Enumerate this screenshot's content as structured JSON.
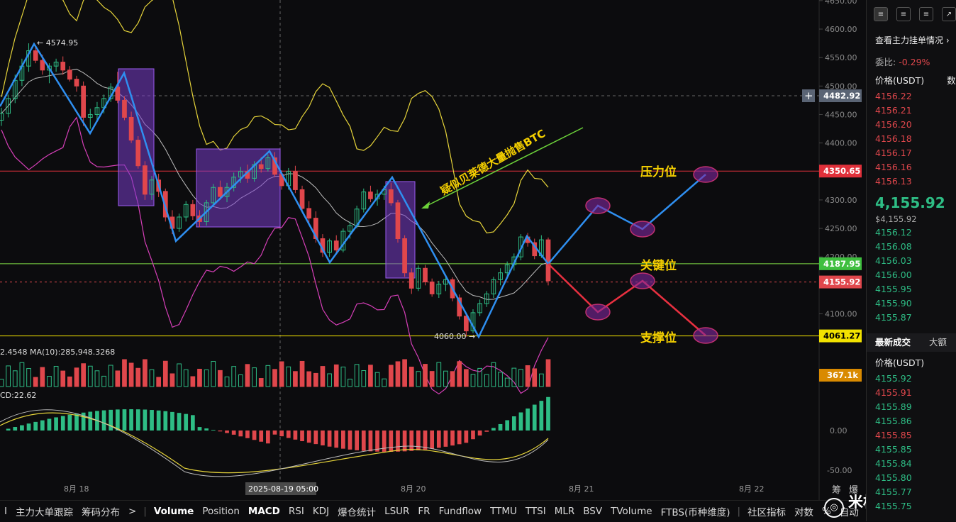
{
  "chart_data": {
    "type": "candlestick",
    "price_axis": {
      "ticks": [
        4650,
        4600,
        4550,
        4500,
        4450,
        4400,
        4350,
        4300,
        4250,
        4200,
        4150,
        4100
      ],
      "tick_labels": [
        "4650.00",
        "4600.00",
        "4550.00",
        "4500.00",
        "4450.00",
        "4400.00",
        "4350.00",
        "4300.00",
        "4250.00",
        "4200.00",
        "4150.00",
        "4100.00"
      ],
      "range": [
        4055,
        4655
      ]
    },
    "time_axis": {
      "labels": [
        "8月 18",
        "8月 19",
        "8月 20",
        "8月 21",
        "8月 22"
      ],
      "crosshair_label": "2025-08-19 05:00"
    },
    "price_tags": [
      {
        "price": 4482.92,
        "label": "4482.92",
        "color": "#5a6474"
      },
      {
        "price": 4350.65,
        "label": "4350.65",
        "color": "#e0303a"
      },
      {
        "price": 4187.95,
        "label": "4187.95",
        "color": "#3fbf3f"
      },
      {
        "price": 4155.92,
        "label": "4155.92",
        "color": "#e0474c"
      },
      {
        "price": 4061.27,
        "label": "4061.27",
        "color": "#f2e200"
      }
    ],
    "horizontal_levels": [
      {
        "price": 4350.65,
        "color": "#e0303a",
        "name": "压力位"
      },
      {
        "price": 4187.95,
        "color": "#7fdc44",
        "name": "关键位"
      },
      {
        "price": 4061.27,
        "color": "#f2e200",
        "name": "支撑位"
      }
    ],
    "annotations": {
      "high_label": "← 4574.95",
      "low_label": "4060.00 →",
      "main_note": "疑似贝莱德大量抛售BTC"
    },
    "candles": [
      [
        4440,
        4462,
        4430,
        4452
      ],
      [
        4452,
        4485,
        4445,
        4478
      ],
      [
        4478,
        4520,
        4470,
        4510
      ],
      [
        4510,
        4548,
        4500,
        4535
      ],
      [
        4535,
        4575,
        4525,
        4562
      ],
      [
        4562,
        4570,
        4540,
        4545
      ],
      [
        4545,
        4555,
        4520,
        4528
      ],
      [
        4528,
        4540,
        4505,
        4535
      ],
      [
        4535,
        4548,
        4525,
        4542
      ],
      [
        4542,
        4552,
        4520,
        4528
      ],
      [
        4528,
        4535,
        4508,
        4512
      ],
      [
        4512,
        4518,
        4490,
        4500
      ],
      [
        4500,
        4508,
        4430,
        4445
      ],
      [
        4445,
        4460,
        4425,
        4450
      ],
      [
        4450,
        4472,
        4440,
        4462
      ],
      [
        4462,
        4485,
        4452,
        4478
      ],
      [
        4478,
        4505,
        4472,
        4498
      ],
      [
        4498,
        4525,
        4470,
        4475
      ],
      [
        4475,
        4482,
        4440,
        4445
      ],
      [
        4445,
        4455,
        4400,
        4405
      ],
      [
        4405,
        4412,
        4355,
        4360
      ],
      [
        4360,
        4368,
        4300,
        4310
      ],
      [
        4310,
        4342,
        4300,
        4335
      ],
      [
        4335,
        4346,
        4305,
        4315
      ],
      [
        4315,
        4320,
        4262,
        4270
      ],
      [
        4270,
        4282,
        4240,
        4250
      ],
      [
        4250,
        4276,
        4244,
        4270
      ],
      [
        4270,
        4298,
        4262,
        4292
      ],
      [
        4292,
        4300,
        4265,
        4272
      ],
      [
        4272,
        4282,
        4252,
        4262
      ],
      [
        4262,
        4300,
        4255,
        4295
      ],
      [
        4295,
        4328,
        4288,
        4322
      ],
      [
        4322,
        4334,
        4300,
        4306
      ],
      [
        4306,
        4330,
        4296,
        4322
      ],
      [
        4322,
        4348,
        4315,
        4340
      ],
      [
        4340,
        4358,
        4330,
        4350
      ],
      [
        4350,
        4362,
        4330,
        4338
      ],
      [
        4338,
        4368,
        4332,
        4362
      ],
      [
        4362,
        4375,
        4348,
        4355
      ],
      [
        4355,
        4380,
        4350,
        4374
      ],
      [
        4374,
        4384,
        4340,
        4345
      ],
      [
        4345,
        4352,
        4318,
        4325
      ],
      [
        4325,
        4356,
        4318,
        4350
      ],
      [
        4350,
        4360,
        4312,
        4318
      ],
      [
        4318,
        4325,
        4278,
        4285
      ],
      [
        4285,
        4298,
        4260,
        4268
      ],
      [
        4268,
        4280,
        4225,
        4232
      ],
      [
        4232,
        4240,
        4200,
        4208
      ],
      [
        4208,
        4232,
        4200,
        4228
      ],
      [
        4228,
        4238,
        4205,
        4212
      ],
      [
        4212,
        4250,
        4208,
        4245
      ],
      [
        4245,
        4262,
        4232,
        4255
      ],
      [
        4255,
        4290,
        4250,
        4284
      ],
      [
        4284,
        4320,
        4278,
        4314
      ],
      [
        4314,
        4325,
        4296,
        4302
      ],
      [
        4302,
        4318,
        4290,
        4310
      ],
      [
        4310,
        4325,
        4300,
        4318
      ],
      [
        4318,
        4330,
        4290,
        4295
      ],
      [
        4295,
        4300,
        4225,
        4232
      ],
      [
        4232,
        4238,
        4165,
        4172
      ],
      [
        4172,
        4180,
        4135,
        4145
      ],
      [
        4145,
        4185,
        4140,
        4180
      ],
      [
        4180,
        4186,
        4150,
        4156
      ],
      [
        4156,
        4162,
        4130,
        4135
      ],
      [
        4135,
        4158,
        4128,
        4152
      ],
      [
        4152,
        4168,
        4140,
        4160
      ],
      [
        4160,
        4164,
        4122,
        4128
      ],
      [
        4128,
        4134,
        4090,
        4096
      ],
      [
        4096,
        4100,
        4060,
        4070
      ],
      [
        4070,
        4108,
        4066,
        4102
      ],
      [
        4102,
        4125,
        4096,
        4118
      ],
      [
        4118,
        4140,
        4112,
        4135
      ],
      [
        4135,
        4165,
        4128,
        4160
      ],
      [
        4160,
        4180,
        4150,
        4172
      ],
      [
        4172,
        4192,
        4165,
        4186
      ],
      [
        4186,
        4206,
        4176,
        4200
      ],
      [
        4200,
        4240,
        4194,
        4235
      ],
      [
        4235,
        4242,
        4218,
        4225
      ],
      [
        4225,
        4232,
        4196,
        4202
      ],
      [
        4202,
        4238,
        4198,
        4230
      ],
      [
        4230,
        4234,
        4150,
        4158
      ]
    ],
    "volume_label": "2.4548  MA(10):285,948.3268",
    "volume_tag": "367.1k",
    "macd_label": "CD:22.62",
    "macd_axis": {
      "ticks": [
        "0.00",
        "-50.00"
      ]
    }
  },
  "tabs": [
    "I",
    "主力大单跟踪",
    "筹码分布",
    ">",
    "Volume",
    "Position",
    "MACD",
    "RSI",
    "KDJ",
    "爆仓统计",
    "LSUR",
    "FR",
    "Fundflow",
    "TTMU",
    "TTSI",
    "MLR",
    "BSV",
    "TVolume",
    "FTBS(币种维度)",
    "社区指标",
    "对数",
    "%",
    "自动"
  ],
  "active_tabs": [
    "Volume",
    "MACD"
  ],
  "corner_labels": [
    "筹",
    "爆"
  ],
  "watermark": "米格说趋势",
  "order_book": {
    "title": "查看主力挂单情况",
    "ratio_label": "委比:",
    "ratio_value": "-0.29%",
    "price_header": "价格(USDT)",
    "qty_header": "数",
    "asks": [
      "4156.22",
      "4156.21",
      "4156.20",
      "4156.18",
      "4156.17",
      "4156.16",
      "4156.13"
    ],
    "last_price": "4,155.92",
    "last_price_usd": "$4,155.92",
    "bids": [
      "4156.12",
      "4156.08",
      "4156.03",
      "4156.00",
      "4155.95",
      "4155.90",
      "4155.87"
    ],
    "trades_tab": "最新成交",
    "trades_tab2": "大额",
    "trades_header": "价格(USDT)",
    "trades": [
      {
        "p": "4155.92",
        "c": "green"
      },
      {
        "p": "4155.91",
        "c": "red"
      },
      {
        "p": "4155.89",
        "c": "green"
      },
      {
        "p": "4155.86",
        "c": "green"
      },
      {
        "p": "4155.85",
        "c": "red"
      },
      {
        "p": "4155.85",
        "c": "green"
      },
      {
        "p": "4155.84",
        "c": "green"
      },
      {
        "p": "4155.80",
        "c": "green"
      },
      {
        "p": "4155.77",
        "c": "green"
      },
      {
        "p": "4155.75",
        "c": "green"
      }
    ]
  }
}
